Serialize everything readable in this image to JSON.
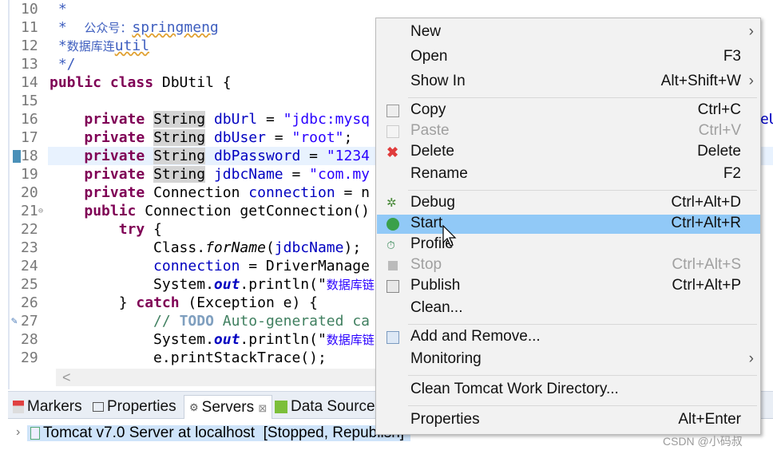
{
  "editor": {
    "lines": [
      {
        "n": "10",
        "t": " *"
      },
      {
        "n": "11",
        "a": " *  ",
        "b": "公众号：",
        "c": "springmeng"
      },
      {
        "n": "12",
        "a": " *",
        "b": "数据库连",
        "c": "util"
      },
      {
        "n": "13",
        "t": " */"
      },
      {
        "n": "14",
        "kw": "public class",
        "rest": " DbUtil {"
      },
      {
        "n": "15",
        "t": ""
      },
      {
        "n": "16",
        "kw": "private",
        "type": "String",
        "fld": "dbUrl",
        "eq": " = ",
        "str": "\"jdbc:mysq",
        "tail": "eU"
      },
      {
        "n": "17",
        "kw": "private",
        "type": "String",
        "fld": "dbUser",
        "eq": " = ",
        "str": "\"root\"",
        "end": ";"
      },
      {
        "n": "18",
        "kw": "private",
        "type": "String",
        "fld": "dbPassword",
        "eq": " = ",
        "str": "\"1234"
      },
      {
        "n": "19",
        "kw": "private",
        "type": "String",
        "fld": "jdbcName",
        "eq": " = ",
        "str": "\"com.my"
      },
      {
        "n": "20",
        "kw": "private",
        "type": "Connection",
        "fld": "connection",
        "eq": " = n"
      },
      {
        "n": "21",
        "kw": "public",
        "rest": " Connection getConnection()"
      },
      {
        "n": "22",
        "kw": "try",
        "rest": " {"
      },
      {
        "n": "23",
        "a": "Class.",
        "it": "forName",
        "p": "(",
        "fld": "jdbcName",
        "end": ");"
      },
      {
        "n": "24",
        "fld": "connection",
        "rest": " = DriverManage"
      },
      {
        "n": "25",
        "a": "System.",
        "bi": "out",
        "rest": ".println(\"",
        "cjk": "数据库链"
      },
      {
        "n": "26",
        "a": "} ",
        "kw": "catch",
        "rest": " (Exception e) {"
      },
      {
        "n": "27",
        "cm": "// ",
        "todo": "TODO",
        "rest": " Auto-generated ca"
      },
      {
        "n": "28",
        "a": "System.",
        "bi": "out",
        "rest": ".println(\"",
        "cjk": "数据库链"
      },
      {
        "n": "29",
        "t": "e.printStackTrace();"
      }
    ],
    "scroll_left": "<"
  },
  "panel": {
    "tabs": [
      {
        "label": "Markers",
        "icon": "markers-icon"
      },
      {
        "label": "Properties",
        "icon": "properties-icon"
      },
      {
        "label": "Servers",
        "icon": "servers-icon",
        "close": "⊠"
      },
      {
        "label": "Data Source",
        "icon": "data-source-icon"
      }
    ],
    "server": {
      "name": "Tomcat v7.0 Server at localhost",
      "status": "[Stopped, Republish]",
      "expand": "›"
    }
  },
  "menu": {
    "items": [
      {
        "label": "New",
        "shortcut": "",
        "submenu": true
      },
      {
        "label": "Open",
        "shortcut": "F3"
      },
      {
        "label": "Show In",
        "shortcut": "Alt+Shift+W",
        "submenu": true
      },
      {
        "label": "Copy",
        "shortcut": "Ctrl+C",
        "icon": "copy-icon"
      },
      {
        "label": "Paste",
        "shortcut": "Ctrl+V",
        "icon": "paste-icon",
        "disabled": true
      },
      {
        "label": "Delete",
        "shortcut": "Delete",
        "icon": "delete-icon"
      },
      {
        "label": "Rename",
        "shortcut": "F2"
      },
      {
        "label": "Debug",
        "shortcut": "Ctrl+Alt+D",
        "icon": "debug-icon"
      },
      {
        "label": "Start",
        "shortcut": "Ctrl+Alt+R",
        "icon": "start-icon",
        "selected": true
      },
      {
        "label": "Profile",
        "shortcut": "",
        "icon": "profile-icon"
      },
      {
        "label": "Stop",
        "shortcut": "Ctrl+Alt+S",
        "icon": "stop-icon",
        "disabled": true
      },
      {
        "label": "Publish",
        "shortcut": "Ctrl+Alt+P",
        "icon": "publish-icon"
      },
      {
        "label": "Clean...",
        "shortcut": ""
      },
      {
        "label": "Add and Remove...",
        "shortcut": "",
        "icon": "add-remove-icon"
      },
      {
        "label": "Monitoring",
        "shortcut": "",
        "submenu": true
      },
      {
        "label": "Clean Tomcat Work Directory...",
        "shortcut": ""
      },
      {
        "label": "Properties",
        "shortcut": "Alt+Enter"
      }
    ],
    "submenu_arrow": "›"
  },
  "watermark": "CSDN @小码叔",
  "colors": {
    "selection": "#91c9f7",
    "current_line": "#e8f2fe",
    "keyword": "#7f0055",
    "field": "#0000c0",
    "string": "#2a00ff"
  }
}
